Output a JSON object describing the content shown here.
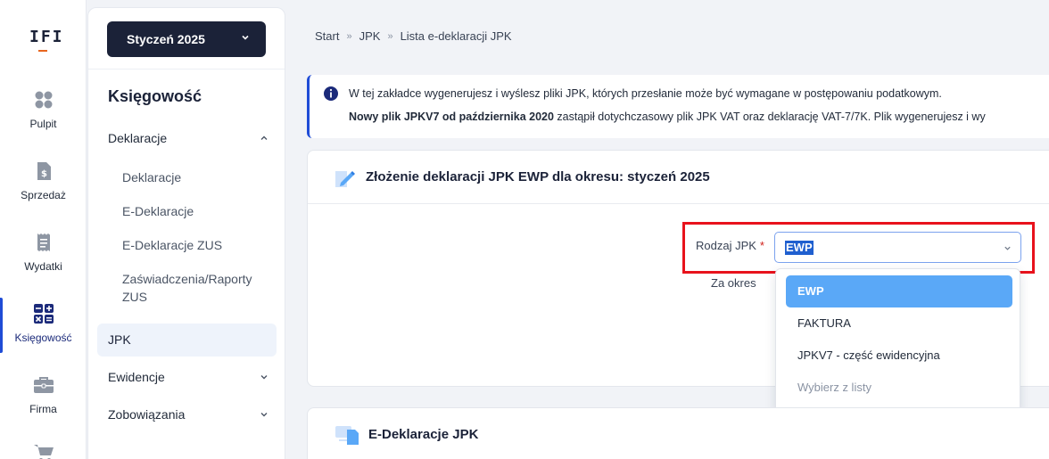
{
  "app": {
    "logo_text": "IFI"
  },
  "rail": {
    "items": [
      {
        "label": "Pulpit",
        "icon": "dashboard-icon"
      },
      {
        "label": "Sprzedaż",
        "icon": "invoice-dollar-icon"
      },
      {
        "label": "Wydatki",
        "icon": "receipt-icon"
      },
      {
        "label": "Księgowość",
        "icon": "calculator-icon"
      },
      {
        "label": "Firma",
        "icon": "briefcase-icon"
      },
      {
        "label": "",
        "icon": "cart-icon"
      }
    ],
    "active": "Księgowość"
  },
  "sidebar": {
    "period_label": "Styczeń 2025",
    "title": "Księgowość",
    "groups": {
      "deklaracje": "Deklaracje",
      "ewidencje": "Ewidencje",
      "zobowiazania": "Zobowiązania"
    },
    "deklaracje_items": [
      "Deklaracje",
      "E-Deklaracje",
      "E-Deklaracje ZUS",
      "Zaświadczenia/Raporty ZUS"
    ],
    "active_item": "JPK"
  },
  "breadcrumb": {
    "items": [
      "Start",
      "JPK",
      "Lista e-deklaracji JPK"
    ]
  },
  "info": {
    "line1": "W tej zakładce wygenerujesz i wyślesz pliki JPK, których przesłanie może być wymagane w postępowaniu podatkowym.",
    "line2_bold": "Nowy plik JPKV7 od października 2020",
    "line2_rest": " zastąpił dotychczasowy plik JPK VAT oraz deklarację VAT-7/7K. Plik wygenerujesz i wy"
  },
  "form_card": {
    "title": "Złożenie deklaracji JPK EWP dla okresu: styczeń 2025",
    "rodzaj_label": "Rodzaj JPK",
    "required_mark": "*",
    "okres_label": "Za okres",
    "selected_value": "EWP",
    "options": [
      "EWP",
      "FAKTURA",
      "JPKV7 - część ewidencyjna",
      "Wybierz z listy"
    ]
  },
  "edekl_card": {
    "title": "E-Deklaracje JPK"
  },
  "colors": {
    "accent": "#1f4cd6",
    "dark": "#1b2238",
    "highlight_red": "#e8121c",
    "option_selected": "#5aa8f7"
  }
}
